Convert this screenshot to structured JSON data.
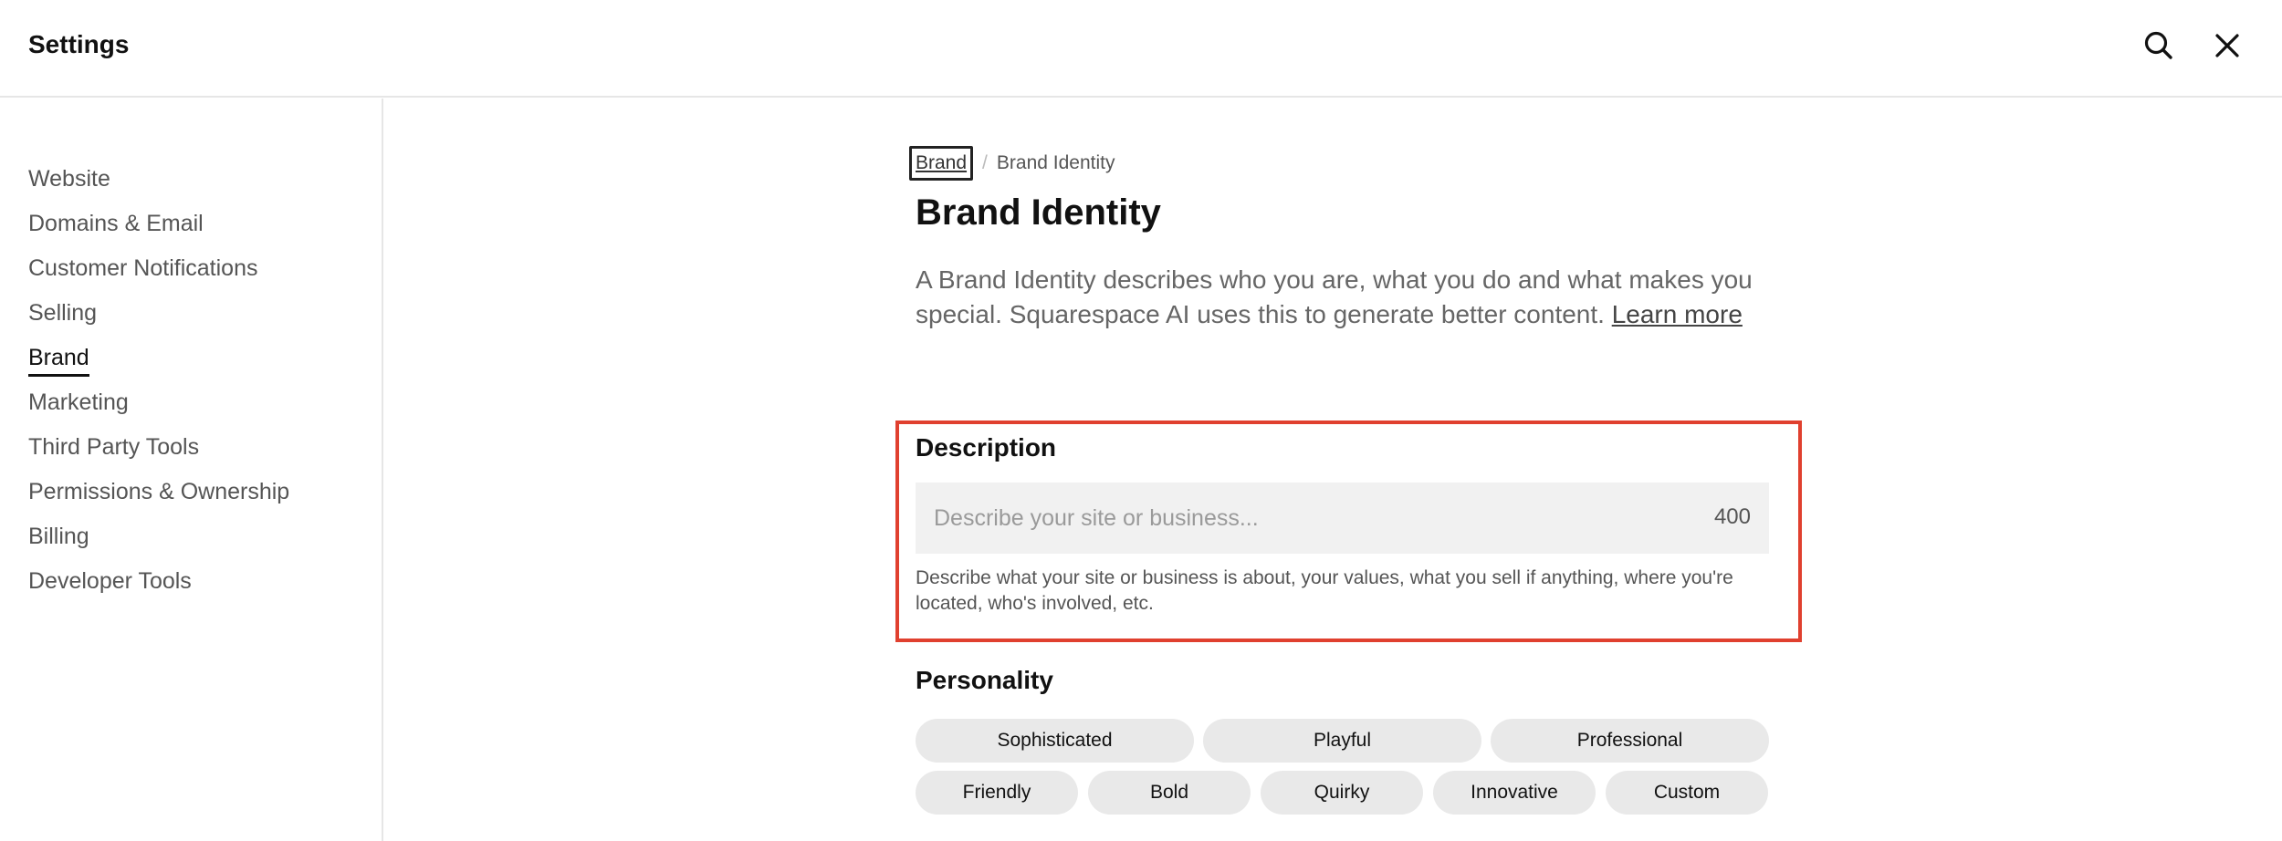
{
  "header": {
    "title": "Settings",
    "search_icon": "search-icon",
    "close_icon": "close-icon"
  },
  "sidebar": {
    "items": [
      {
        "label": "Website"
      },
      {
        "label": "Domains & Email"
      },
      {
        "label": "Customer Notifications"
      },
      {
        "label": "Selling"
      },
      {
        "label": "Brand",
        "active": true
      },
      {
        "label": "Marketing"
      },
      {
        "label": "Third Party Tools"
      },
      {
        "label": "Permissions & Ownership"
      },
      {
        "label": "Billing"
      },
      {
        "label": "Developer Tools"
      }
    ]
  },
  "breadcrumb": {
    "parent": "Brand",
    "separator": "/",
    "current": "Brand Identity"
  },
  "page": {
    "title": "Brand Identity",
    "intro": "A Brand Identity describes who you are, what you do and what makes you special. Squarespace AI uses this to generate better content.",
    "learn_more": "Learn more"
  },
  "description": {
    "label": "Description",
    "value": "",
    "placeholder": "Describe your site or business...",
    "char_count": "400",
    "help": "Describe what your site or business is about, your values, what you sell if anything, where you're located, who's involved, etc.",
    "highlight_color": "#e0402f"
  },
  "personality": {
    "label": "Personality",
    "row1": [
      "Sophisticated",
      "Playful",
      "Professional"
    ],
    "row2": [
      "Friendly",
      "Bold",
      "Quirky",
      "Innovative",
      "Custom"
    ]
  }
}
